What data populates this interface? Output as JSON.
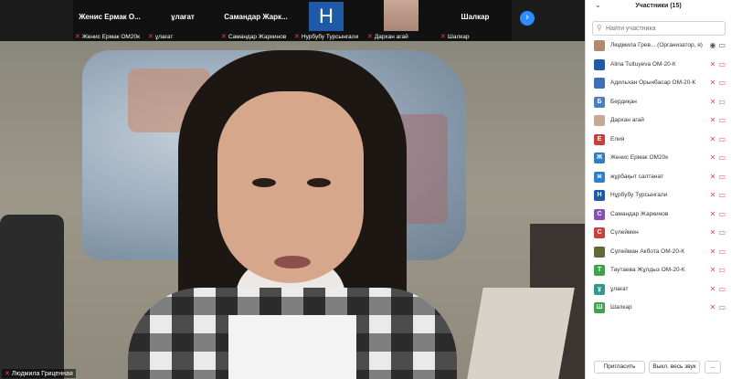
{
  "thumbnails": [
    {
      "name": "Женис Ермак О...",
      "label": "Женис Ермак ОМ20к",
      "type": "name"
    },
    {
      "name": "ұлағат",
      "label": "ұлағат",
      "type": "name"
    },
    {
      "name": "Самандар Жарк...",
      "label": "Самандар Жаркинов",
      "type": "name"
    },
    {
      "name": "",
      "label": "Нурбубу Турсынгали",
      "type": "avatar",
      "avatar": "Н"
    },
    {
      "name": "",
      "label": "Дархан агай",
      "type": "photo"
    },
    {
      "name": "Шалкар",
      "label": "Шалкар",
      "type": "name"
    }
  ],
  "main": {
    "speaker_label": "Людмила Гриценная"
  },
  "panel": {
    "title": "Участники (15)",
    "search_placeholder": "Найти участника",
    "participants": [
      {
        "initial": "",
        "name": "Людмила Грев... (Организатор, я)",
        "color": "#b08a70",
        "mic": "ok"
      },
      {
        "initial": "",
        "name": "Alina Tultuyeva ОМ-20-К",
        "color": "#1e5aa8",
        "mic": "off"
      },
      {
        "initial": "",
        "name": "Адильхан Орынбасар ОМ-20-К",
        "color": "#3b6fb6",
        "mic": "off"
      },
      {
        "initial": "Б",
        "name": "Бердиқан",
        "color": "#4a7ec2",
        "mic": "off"
      },
      {
        "initial": "",
        "name": "Дархан агай",
        "color": "#c9a898",
        "mic": "off"
      },
      {
        "initial": "Е",
        "name": "Елия",
        "color": "#c94040",
        "mic": "off"
      },
      {
        "initial": "Ж",
        "name": "Женис Ермак ОМ20к",
        "color": "#2f7fc8",
        "mic": "off"
      },
      {
        "initial": "ж",
        "name": "жұрбақыт салтанат",
        "color": "#2f7fc8",
        "mic": "off"
      },
      {
        "initial": "Н",
        "name": "Нұрбубу Турсынгали",
        "color": "#1e5aa8",
        "mic": "off"
      },
      {
        "initial": "С",
        "name": "Самандар Жаркинов",
        "color": "#8a4fb5",
        "mic": "off"
      },
      {
        "initial": "С",
        "name": "Сүлеймен",
        "color": "#c94040",
        "mic": "off"
      },
      {
        "initial": "",
        "name": "Сулейман Акбота ОМ-20-К",
        "color": "#5c6b3a",
        "mic": "off"
      },
      {
        "initial": "Т",
        "name": "Таутаева Жұлдыз ОМ-20-К",
        "color": "#3fa34d",
        "mic": "off"
      },
      {
        "initial": "ұ",
        "name": "ұлағат",
        "color": "#2f9a8a",
        "mic": "off"
      },
      {
        "initial": "Ш",
        "name": "Шалкар",
        "color": "#3fa34d",
        "mic": "off"
      }
    ],
    "invite_label": "Пригласить",
    "mute_all_label": "Выкл. весь звук",
    "more_label": "..."
  }
}
